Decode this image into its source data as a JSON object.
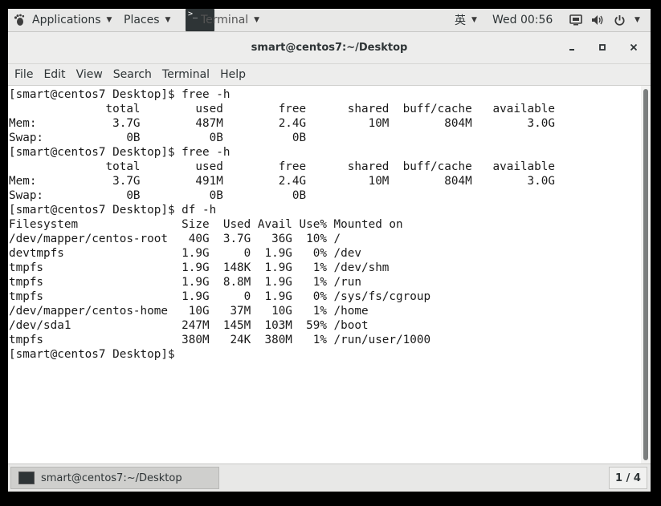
{
  "topbar": {
    "applications": "Applications",
    "places": "Places",
    "terminal": "Terminal",
    "terminal_icon_glyph": ">_",
    "input_method": "英",
    "clock": "Wed 00:56"
  },
  "window": {
    "title": "smart@centos7:~/Desktop"
  },
  "menu": {
    "items": [
      "File",
      "Edit",
      "View",
      "Search",
      "Terminal",
      "Help"
    ]
  },
  "terminal": {
    "lines": [
      "[smart@centos7 Desktop]$ free -h",
      "              total        used        free      shared  buff/cache   available",
      "Mem:           3.7G        487M        2.4G         10M        804M        3.0G",
      "Swap:            0B          0B          0B",
      "[smart@centos7 Desktop]$ free -h",
      "              total        used        free      shared  buff/cache   available",
      "Mem:           3.7G        491M        2.4G         10M        804M        3.0G",
      "Swap:            0B          0B          0B",
      "[smart@centos7 Desktop]$ df -h",
      "Filesystem               Size  Used Avail Use% Mounted on",
      "/dev/mapper/centos-root   40G  3.7G   36G  10% /",
      "devtmpfs                 1.9G     0  1.9G   0% /dev",
      "tmpfs                    1.9G  148K  1.9G   1% /dev/shm",
      "tmpfs                    1.9G  8.8M  1.9G   1% /run",
      "tmpfs                    1.9G     0  1.9G   0% /sys/fs/cgroup",
      "/dev/mapper/centos-home   10G   37M   10G   1% /home",
      "/dev/sda1                247M  145M  103M  59% /boot",
      "tmpfs                    380M   24K  380M   1% /run/user/1000",
      "[smart@centos7 Desktop]$"
    ]
  },
  "taskbar": {
    "task_label": "smart@centos7:~/Desktop",
    "workspace": "1 / 4"
  },
  "icons": {
    "app_menu": "foot-icon",
    "dropdown": "chevron-down-icon",
    "screen": "display-icon",
    "volume": "volume-icon",
    "power": "power-icon",
    "minimize": "minimize-icon",
    "maximize": "maximize-icon",
    "close": "close-icon"
  }
}
